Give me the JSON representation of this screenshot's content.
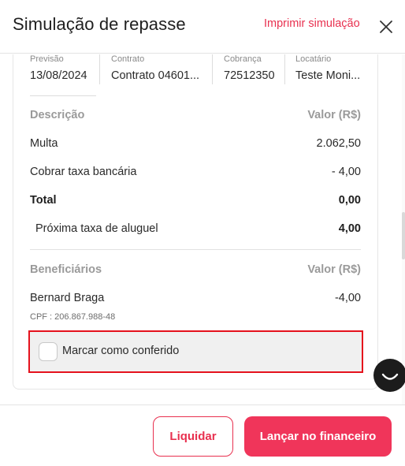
{
  "header": {
    "title": "Simulação de repasse",
    "print_link": "Imprimir simulação",
    "close_icon": "close-icon"
  },
  "info": [
    {
      "label": "Previsão",
      "value": "13/08/2024"
    },
    {
      "label": "Contrato",
      "value": "Contrato 04601..."
    },
    {
      "label": "Cobrança",
      "value": "72512350"
    },
    {
      "label": "Locatário",
      "value": "Teste Moni..."
    }
  ],
  "items": {
    "header_desc": "Descrição",
    "header_value": "Valor (R$)",
    "rows": [
      {
        "label": "Multa",
        "value": "2.062,50"
      },
      {
        "label": "Cobrar taxa bancária",
        "value": "- 4,00"
      }
    ],
    "total_label": "Total",
    "total_value": "0,00",
    "next_fee_label": "Próxima taxa de aluguel",
    "next_fee_value": "4,00"
  },
  "beneficiaries": {
    "header_label": "Beneficiários",
    "header_value": "Valor (R$)",
    "name": "Bernard Braga",
    "value": "-4,00",
    "cpf": "CPF : 206.867.988-48"
  },
  "checkbox": {
    "label": "Marcar como conferido",
    "checked": false
  },
  "footer": {
    "secondary_button": "Liquidar",
    "primary_button": "Lançar no financeiro"
  },
  "colors": {
    "accent": "#e8304f",
    "primary_button": "#f0355a",
    "highlight_border": "#e5121d"
  },
  "chat_icon": "chat-smile-icon"
}
